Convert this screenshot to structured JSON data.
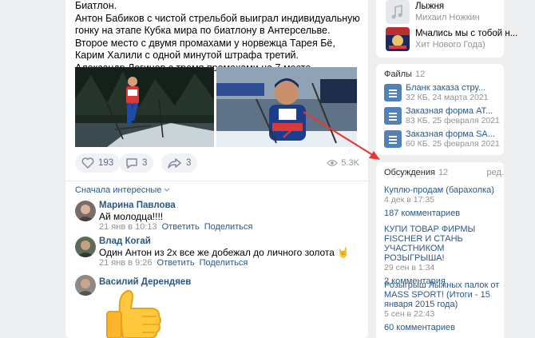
{
  "post": {
    "lines": [
      "Биатлон.",
      "Антон Бабиков с чистой стрельбой выиграл индивидуальную гонку на этапе Кубка мира по биатлону в Антерсельве.",
      "Второе место с двумя промахами у норвежца Тарея Бё, Карим Халили с одной минутой штрафа третий.",
      "Александр Логинов с тремя промахами на 7 месте."
    ],
    "likes": "193",
    "comments": "3",
    "shares": "3",
    "views": "5.3K"
  },
  "comments_section": {
    "sort_label": "Сначала интересные",
    "items": [
      {
        "name": "Марина Павлова",
        "text": "Ай молодца!!!!",
        "date": "21 янв в 10:13",
        "reply": "Ответить",
        "share": "Поделиться"
      },
      {
        "name": "Влад Когай",
        "text": "Один Антон из 2х все же добежал до личного золота 🤘",
        "date": "21 янв в 9:26",
        "reply": "Ответить",
        "share": "Поделиться"
      },
      {
        "name": "Василий Дерендяев"
      }
    ]
  },
  "audio": {
    "items": [
      {
        "title": "Лыжня",
        "artist": "Михаил Ножкин"
      },
      {
        "title": "Мчались мы с тобой н...",
        "artist": "Хит Нового Года)"
      }
    ]
  },
  "files": {
    "title": "Файлы",
    "count": "12",
    "items": [
      {
        "name": "Бланк заказа стру...",
        "meta": "32 КБ, 24 марта 2021"
      },
      {
        "name": "Заказная форма АТ...",
        "meta": "83 КБ, 25 февраля 2021"
      },
      {
        "name": "Заказная форма SA...",
        "meta": "60 КБ, 25 февраля 2021"
      }
    ]
  },
  "discussions": {
    "title": "Обсуждения",
    "count": "12",
    "edit": "ред.",
    "items": [
      {
        "title": "Куплю-продам (барахолка)",
        "date": "4 дек в 17:35",
        "comments": "187 комментариев"
      },
      {
        "title": "КУПИ ТОВАР ФИРМЫ FISCHER И СТАНЬ УЧАСТНИКОМ РОЗЫГРЫША!",
        "date": "29 сен в 1:34",
        "comments": "2 комментария"
      },
      {
        "title": "Розыгрыш Лыжных палок от MASS SPORT! (Итоги - 15 января 2015 года)",
        "date": "5 сен в 22:43",
        "comments": "60 комментариев"
      }
    ]
  },
  "colors": {
    "link": "#2a5885",
    "accent": "#5181b8",
    "annotation_arrow": "#e53935",
    "background": "#edeef0"
  },
  "icons": [
    "heart-icon",
    "comment-icon",
    "share-icon",
    "eye-icon",
    "music-note-icon",
    "document-icon",
    "chevron-down-icon",
    "thumbs-up-icon"
  ]
}
